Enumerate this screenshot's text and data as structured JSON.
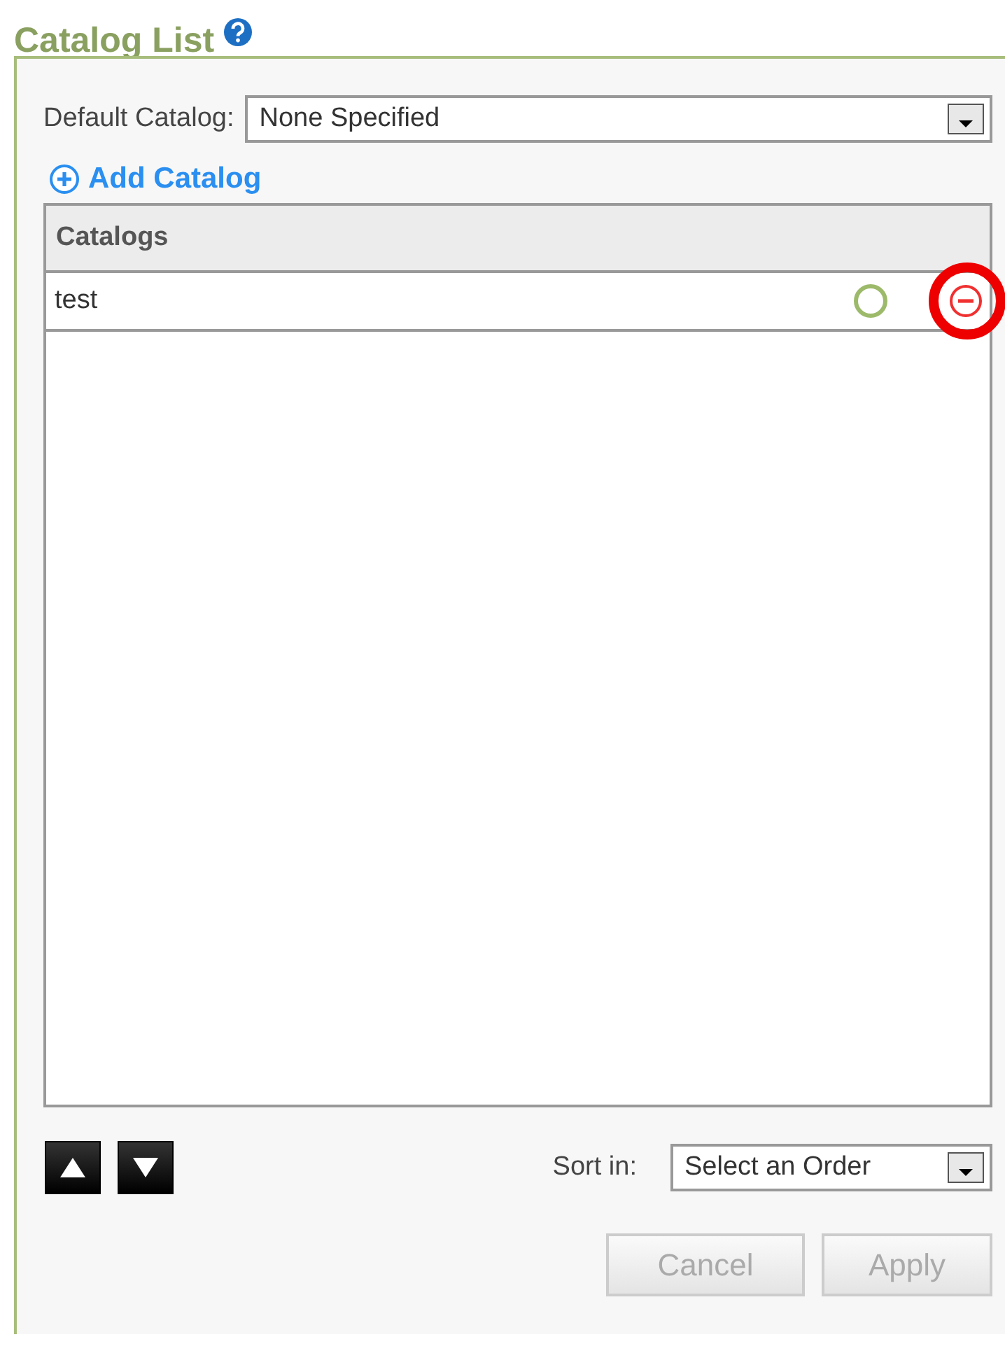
{
  "title": "Catalog List",
  "default_catalog": {
    "label": "Default Catalog:",
    "value": "None Specified"
  },
  "add_link": "Add Catalog",
  "table": {
    "column": "Catalogs",
    "rows": [
      {
        "name": "test",
        "default": false,
        "remove_highlighted": true
      }
    ]
  },
  "sort": {
    "label": "Sort in:",
    "value": "Select an Order"
  },
  "buttons": [
    {
      "label": "Cancel",
      "disabled": true
    },
    {
      "label": "Apply",
      "disabled": true
    }
  ]
}
